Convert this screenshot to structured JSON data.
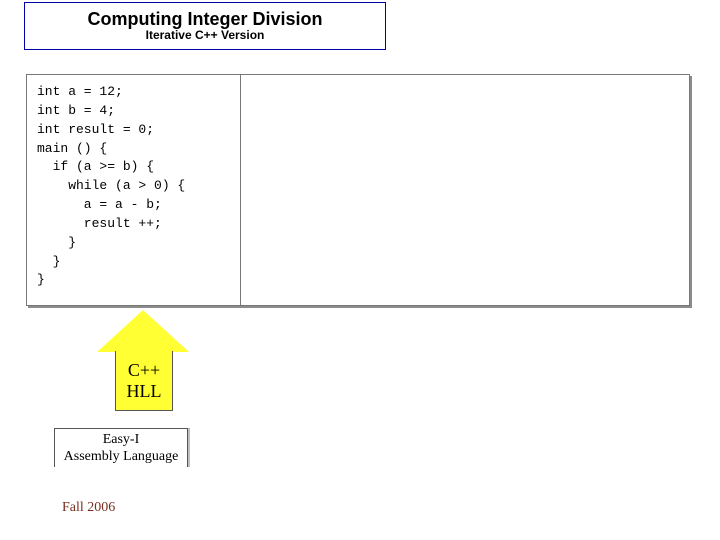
{
  "title": {
    "main": "Computing Integer Division",
    "sub": "Iterative C++ Version"
  },
  "code": "int a = 12;\nint b = 4;\nint result = 0;\nmain () {\n  if (a >= b) {\n    while (a > 0) {\n      a = a - b;\n      result ++;\n    }\n  }\n}",
  "arrows": {
    "up": {
      "line1": "C++",
      "line2": "HLL"
    },
    "down": {
      "line1": "Easy-I",
      "line2": "Assembly Language"
    }
  },
  "footer": "Fall 2006"
}
